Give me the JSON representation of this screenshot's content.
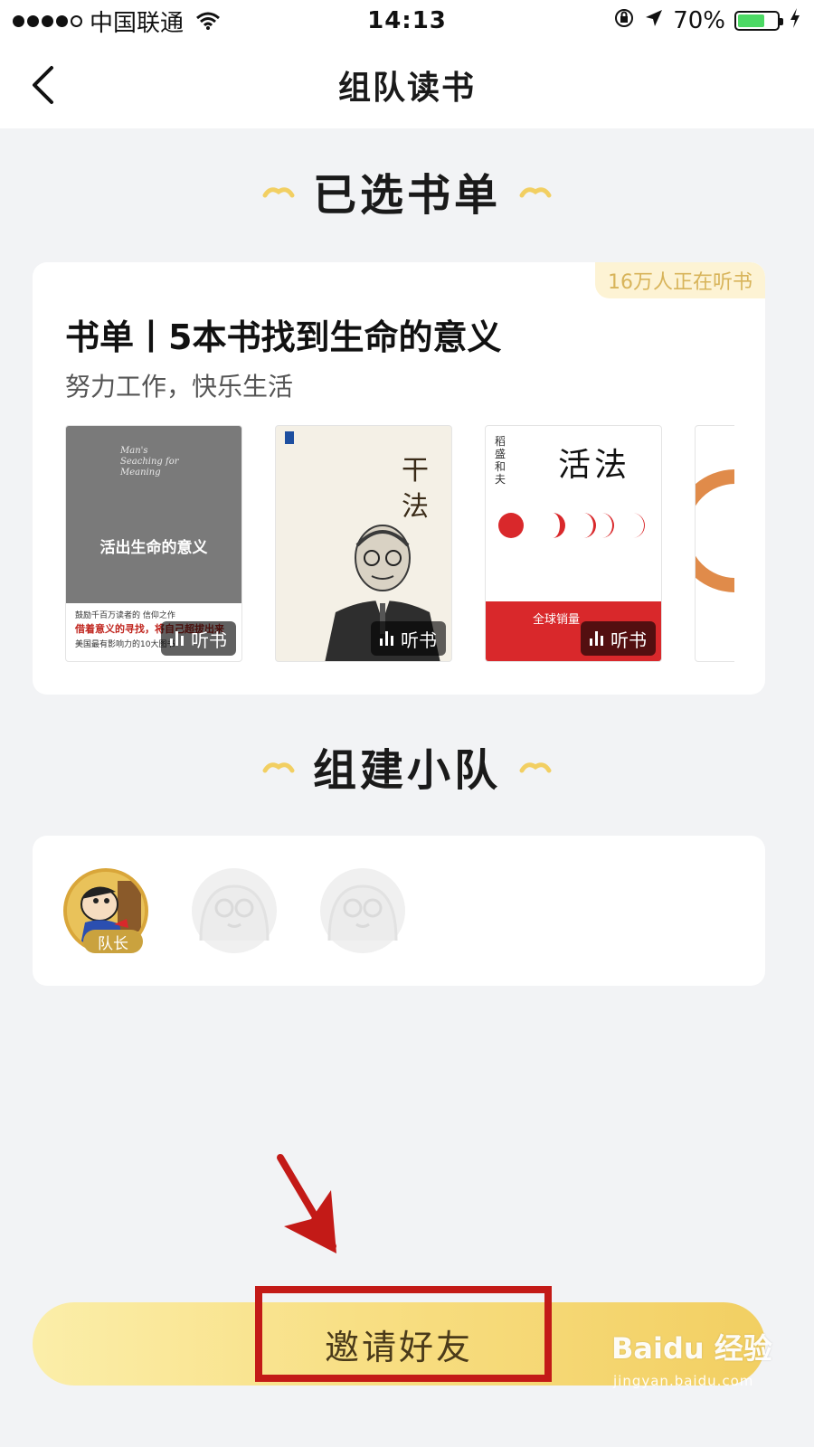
{
  "status_bar": {
    "carrier": "中国联通",
    "time": "14:13",
    "battery_percent": "70%",
    "battery_level": 0.7,
    "signal_filled": 4,
    "signal_total": 5
  },
  "nav": {
    "title": "组队读书",
    "back_icon": "chevron-left-icon"
  },
  "sections": {
    "selected_list": "已选书单",
    "build_team": "组建小队"
  },
  "booklist": {
    "listeners": "16万人正在听书",
    "title": "书单丨5本书找到生命的意义",
    "subtitle": "努力工作，快乐生活",
    "listen_label": "听书",
    "books": [
      {
        "cover_title": "活出生命的意义",
        "cover_en": "Man's Seaching for Meaning",
        "cover_line1": "鼓励千百万读者的 信仰之作",
        "cover_line2": "借着意义的寻找，将自己超拔出来",
        "cover_line3": "美国最有影响力的10大图书"
      },
      {
        "cover_title": "干法"
      },
      {
        "cover_title": "活法",
        "cover_author": "稻盛和夫",
        "cover_band": "全球销量"
      },
      {}
    ]
  },
  "team": {
    "captain_label": "队长",
    "filled_slots": 1,
    "total_slots": 3
  },
  "invite": {
    "label": "邀请好友"
  },
  "watermark": {
    "brand": "Baidu 经验",
    "url": "jingyan.baidu.com"
  },
  "colors": {
    "accent_gold": "#f2cf62",
    "highlight_red": "#c31a17",
    "background": "#f2f3f5"
  }
}
